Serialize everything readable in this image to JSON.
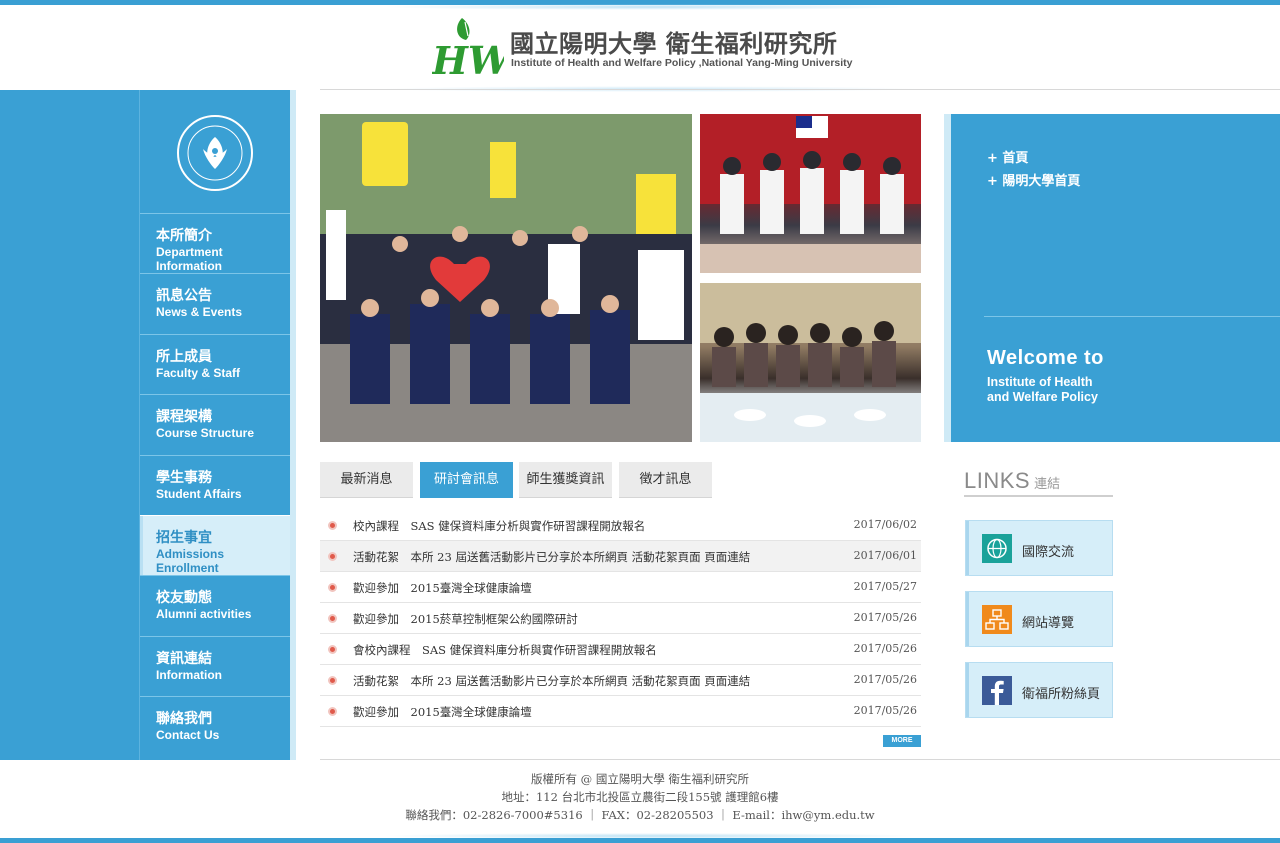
{
  "header": {
    "title_zh": "國立陽明大學 衛生福利研究所",
    "title_en": "Institute of Health and Welfare Policy ,National Yang-Ming University",
    "logo_mark": "HW"
  },
  "sidebar": {
    "items": [
      {
        "zh": "本所簡介",
        "en": "Department Information"
      },
      {
        "zh": "訊息公告",
        "en": "News & Events"
      },
      {
        "zh": "所上成員",
        "en": "Faculty & Staff"
      },
      {
        "zh": "課程架構",
        "en": "Course Structure"
      },
      {
        "zh": "學生事務",
        "en": "Student Affairs"
      },
      {
        "zh": "招生事宜",
        "en": "Admissions Enrollment"
      },
      {
        "zh": "校友動態",
        "en": "Alumni activities"
      },
      {
        "zh": "資訊連結",
        "en": "Information"
      },
      {
        "zh": "聯絡我們",
        "en": "Contact Us"
      }
    ],
    "active_index": 5
  },
  "welcome": {
    "links": [
      "+ 首頁",
      "+ 陽明大學首頁"
    ],
    "title": "Welcome to",
    "subtitle_line1": "Institute of Health",
    "subtitle_line2": "and Welfare Policy"
  },
  "tabs": [
    "最新消息",
    "研討會訊息",
    "師生獲獎資訊",
    "徵才訊息"
  ],
  "active_tab": 1,
  "news": [
    {
      "title": "校內課程　SAS 健保資料庫分析與實作研習課程開放報名",
      "date": "2017/06/02"
    },
    {
      "title": "活動花絮　本所 23 屆送舊活動影片已分享於本所網頁 活動花絮頁面 頁面連結",
      "date": "2017/06/01"
    },
    {
      "title": "歡迎參加　2015臺灣全球健康論壇",
      "date": "2017/05/27"
    },
    {
      "title": "歡迎參加　2015菸草控制框架公約國際研討",
      "date": "2017/05/26"
    },
    {
      "title": "會校內課程　SAS 健保資料庫分析與實作研習課程開放報名",
      "date": "2017/05/26"
    },
    {
      "title": "活動花絮　本所 23 屆送舊活動影片已分享於本所網頁 活動花絮頁面 頁面連結",
      "date": "2017/05/26"
    },
    {
      "title": "歡迎參加　2015臺灣全球健康論壇",
      "date": "2017/05/26"
    }
  ],
  "more_label": "MORE",
  "links": {
    "title_en": "LINKS",
    "title_zh": "連結",
    "items": [
      {
        "label": "國際交流",
        "icon": "globe-icon",
        "color": "#1aa29a"
      },
      {
        "label": "網站導覽",
        "icon": "sitemap-icon",
        "color": "#f08a1c"
      },
      {
        "label": "衛福所粉絲頁",
        "icon": "facebook-icon",
        "color": "#3b5a98"
      }
    ]
  },
  "footer": {
    "line1": "版權所有 @ 國立陽明大學 衛生福利研究所",
    "line2": "地址：112 台北市北投區立農街二段155號 護理館6樓",
    "line3": "聯絡我們：02-2826-7000#5316 ｜ FAX：02-28205503 ｜ E-mail：ihw@ym.edu.tw"
  },
  "colors": {
    "primary": "#3aa0d4",
    "light": "#d6eef9",
    "logo_green": "#2e9b32"
  }
}
